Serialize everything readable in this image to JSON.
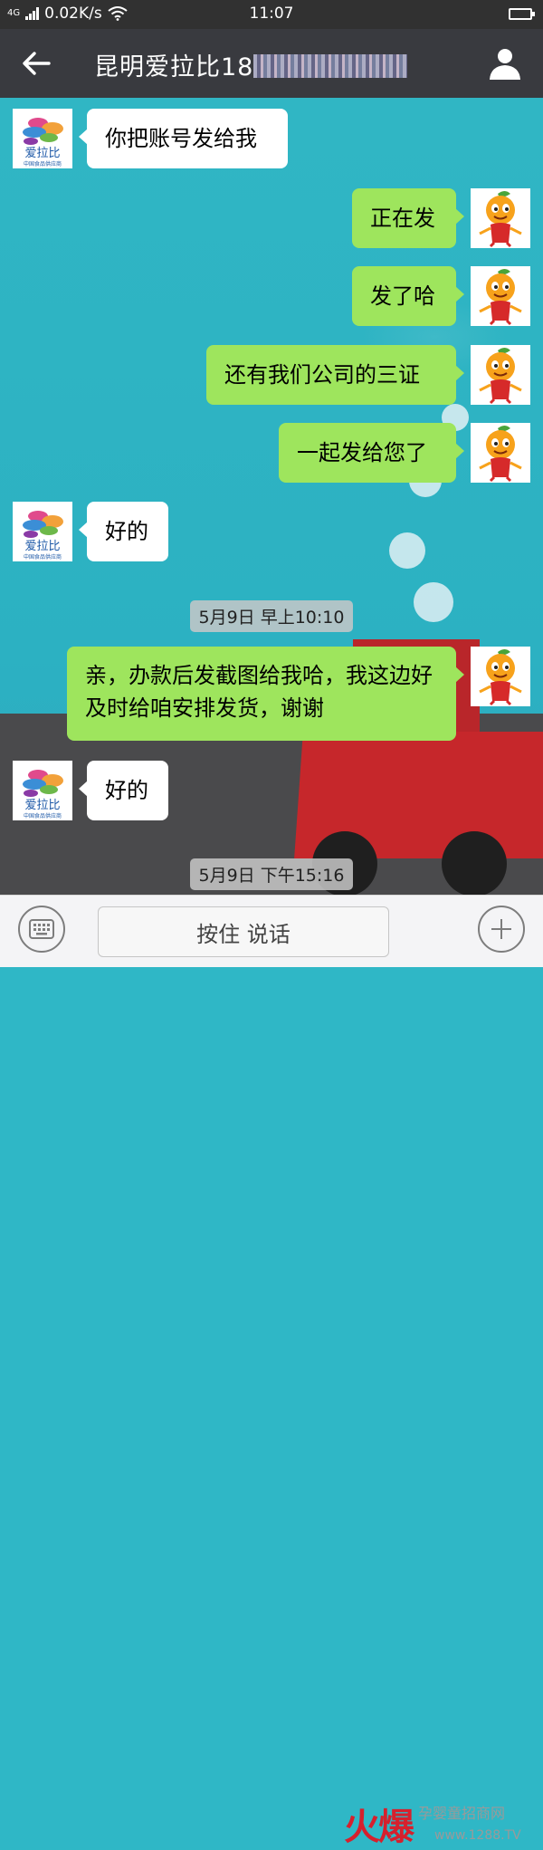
{
  "status_bar": {
    "network_type": "4G",
    "speed": "0.02K/s",
    "time": "11:07"
  },
  "header": {
    "title": "昆明爱拉比18",
    "back_icon": "arrow-left-icon",
    "profile_icon": "user-icon"
  },
  "messages": [
    {
      "direction": "in",
      "text": "你把账号发给我"
    },
    {
      "direction": "out",
      "text": "正在发"
    },
    {
      "direction": "out",
      "text": "发了哈"
    },
    {
      "direction": "out",
      "text": "还有我们公司的三证"
    },
    {
      "direction": "out",
      "text": "一起发给您了"
    },
    {
      "direction": "in",
      "text": "好的"
    },
    {
      "direction": "out",
      "text": "亲，办款后发截图给我哈，我这边好及时给咱安排发货，谢谢"
    },
    {
      "direction": "in",
      "text": "好的"
    }
  ],
  "timestamps": [
    "5月9日 早上10:10",
    "5月9日 下午15:16"
  ],
  "avatars": {
    "contact_logo_text": "爱拉比",
    "contact_logo_subtext": "中国食品供应商",
    "self_icon": "orange-mascot-icon"
  },
  "input_bar": {
    "keyboard_icon": "keyboard-icon",
    "hold_to_talk": "按住 说话",
    "plus_icon": "plus-icon"
  },
  "watermark": {
    "brand": "火爆",
    "site_name": "孕婴童招商网",
    "url": "www.1288.TV"
  },
  "colors": {
    "outgoing_bubble": "#9ee55d",
    "incoming_bubble": "#ffffff",
    "header_bg": "#393a3f",
    "watermark_red": "#d6202d"
  }
}
